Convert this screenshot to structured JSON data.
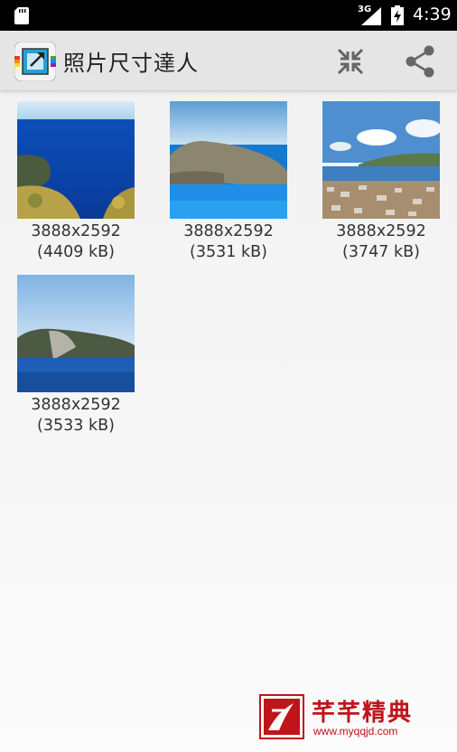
{
  "status_bar": {
    "network": "3G",
    "time": "4:39"
  },
  "action_bar": {
    "title": "照片尺寸達人"
  },
  "photos": [
    {
      "dimensions": "3888x2592",
      "size": "(4409 kB)"
    },
    {
      "dimensions": "3888x2592",
      "size": "(3531 kB)"
    },
    {
      "dimensions": "3888x2592",
      "size": "(3747 kB)"
    },
    {
      "dimensions": "3888x2592",
      "size": "(3533 kB)"
    }
  ],
  "watermark": {
    "title": "芊芊精典",
    "url": "www.myqqjd.com"
  }
}
